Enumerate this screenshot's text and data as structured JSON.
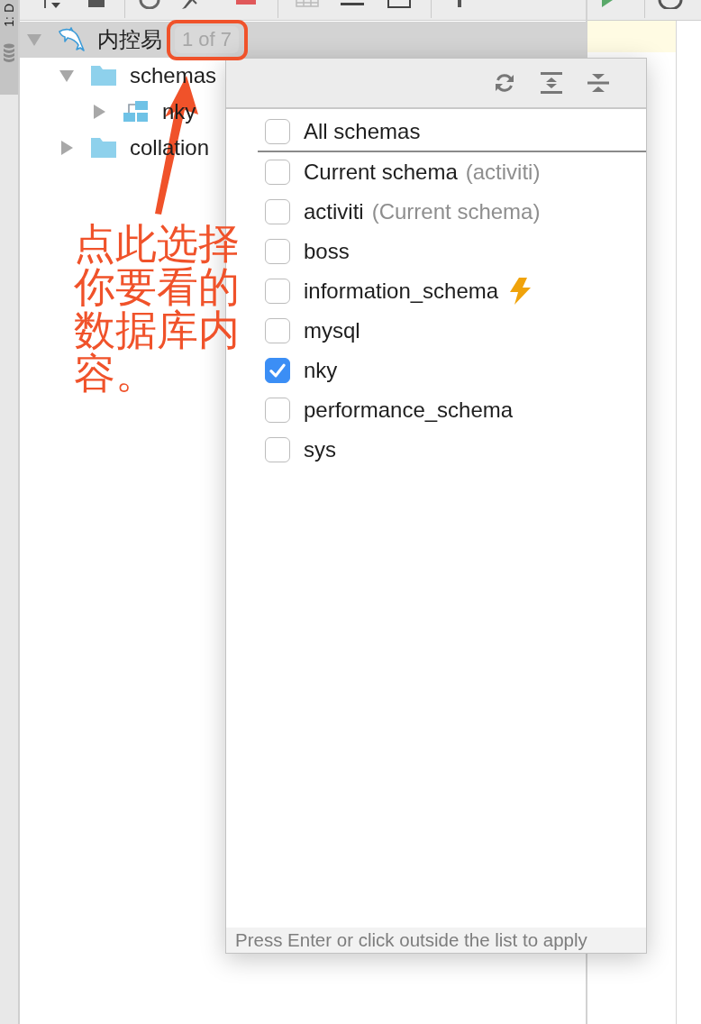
{
  "tool_stripe": {
    "label": "1: D",
    "selected": true
  },
  "tree": {
    "nodes": [
      {
        "label": "内控易",
        "kind": "connection",
        "badge": "1 of 7",
        "expanded": true,
        "selected": true,
        "children": [
          {
            "label": "schemas",
            "kind": "folder",
            "expanded": true,
            "selected": false,
            "children": [
              {
                "label": "nky",
                "kind": "schema",
                "expanded": false,
                "selected": false
              }
            ]
          },
          {
            "label": "collation",
            "kind": "folder",
            "expanded": false,
            "selected": false
          }
        ]
      }
    ]
  },
  "schema_popup": {
    "options": [
      {
        "kind": "all",
        "label": "All schemas",
        "checked": false
      },
      {
        "kind": "schema",
        "label": "Current schema",
        "note": "(activiti)",
        "checked": false
      },
      {
        "kind": "schema",
        "label": "activiti",
        "note": "(Current schema)",
        "checked": false
      },
      {
        "kind": "schema",
        "label": "boss",
        "checked": false
      },
      {
        "kind": "system",
        "label": "information_schema",
        "checked": false
      },
      {
        "kind": "schema",
        "label": "mysql",
        "checked": false
      },
      {
        "kind": "schema",
        "label": "nky",
        "checked": true
      },
      {
        "kind": "schema",
        "label": "performance_schema",
        "checked": false
      },
      {
        "kind": "schema",
        "label": "sys",
        "checked": false
      }
    ],
    "hint": "Press Enter or click outside the list to apply"
  },
  "annotation": {
    "text": "点此选择你要看的数据库内容。"
  }
}
